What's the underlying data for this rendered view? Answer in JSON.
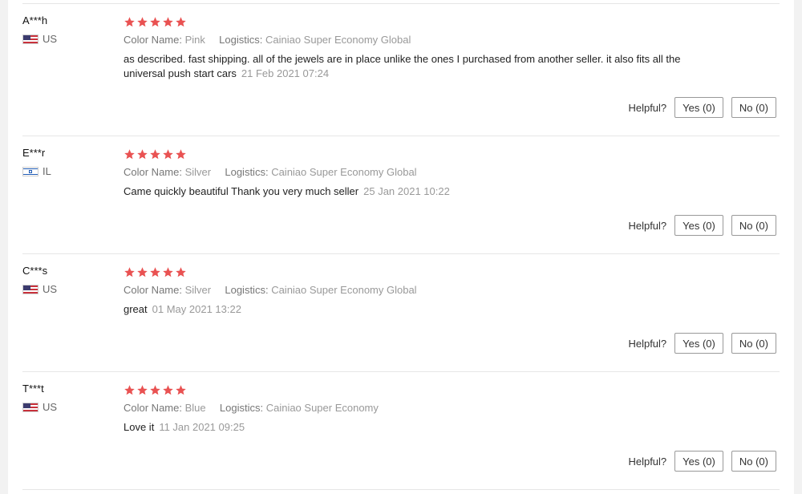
{
  "colors": {
    "star": "#e95252",
    "divider": "#e6e6e6"
  },
  "reviews": [
    {
      "username": "A***h",
      "country": "US",
      "flag_icon": "us-flag-icon",
      "rating": 5,
      "attr1_key": "Color Name:",
      "attr1_value": "Pink",
      "attr2_key": "Logistics:",
      "attr2_value": "Cainiao Super Economy Global",
      "text": "as described. fast shipping. all of the jewels are in place unlike the ones I purchased from another seller. it also fits all the universal push start cars",
      "date": "21 Feb 2021 07:24",
      "helpful_label": "Helpful?",
      "yes_label": "Yes (0)",
      "no_label": "No (0)"
    },
    {
      "username": "E***r",
      "country": "IL",
      "flag_icon": "il-flag-icon",
      "rating": 5,
      "attr1_key": "Color Name:",
      "attr1_value": "Silver",
      "attr2_key": "Logistics:",
      "attr2_value": "Cainiao Super Economy Global",
      "text": "Came quickly beautiful Thank you very much seller",
      "date": "25 Jan 2021 10:22",
      "helpful_label": "Helpful?",
      "yes_label": "Yes (0)",
      "no_label": "No (0)"
    },
    {
      "username": "C***s",
      "country": "US",
      "flag_icon": "us-flag-icon",
      "rating": 5,
      "attr1_key": "Color Name:",
      "attr1_value": "Silver",
      "attr2_key": "Logistics:",
      "attr2_value": "Cainiao Super Economy Global",
      "text": "great",
      "date": "01 May 2021 13:22",
      "helpful_label": "Helpful?",
      "yes_label": "Yes (0)",
      "no_label": "No (0)"
    },
    {
      "username": "T***t",
      "country": "US",
      "flag_icon": "us-flag-icon",
      "rating": 5,
      "attr1_key": "Color Name:",
      "attr1_value": "Blue",
      "attr2_key": "Logistics:",
      "attr2_value": "Cainiao Super Economy",
      "text": "Love it",
      "date": "11 Jan 2021 09:25",
      "helpful_label": "Helpful?",
      "yes_label": "Yes (0)",
      "no_label": "No (0)"
    }
  ]
}
